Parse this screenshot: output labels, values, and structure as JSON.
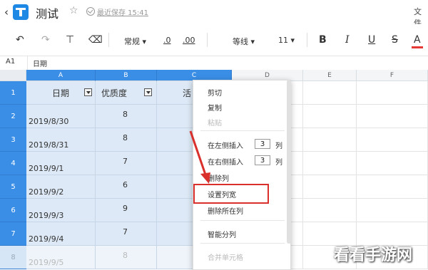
{
  "title_bar": {
    "back_glyph": "‹",
    "doc_title": "测试",
    "save_status": "最近保存 15:41",
    "file_menu": "文件"
  },
  "toolbar": {
    "font_format": "常规",
    "dec_decrease": ".0",
    "dec_increase": ".00",
    "font_name": "等线",
    "font_size": "11",
    "bold": "B",
    "italic": "I",
    "underline": "U",
    "strike": "S",
    "font_color": "A"
  },
  "formula_bar": {
    "cell_ref": "A1",
    "value": "日期"
  },
  "columns": [
    "A",
    "B",
    "C",
    "D",
    "E",
    "F"
  ],
  "header_row": {
    "row_no": "1",
    "date_header": "日期",
    "quality_header": "优质度",
    "c_header": "活"
  },
  "rows": [
    {
      "row_no": "2",
      "date": "2019/8/30",
      "value": "8"
    },
    {
      "row_no": "3",
      "date": "2019/8/31",
      "value": "8"
    },
    {
      "row_no": "4",
      "date": "2019/9/1",
      "value": "7"
    },
    {
      "row_no": "5",
      "date": "2019/9/2",
      "value": "6"
    },
    {
      "row_no": "6",
      "date": "2019/9/3",
      "value": "9"
    },
    {
      "row_no": "7",
      "date": "2019/9/4",
      "value": "7"
    },
    {
      "row_no": "8",
      "date": "2019/9/5",
      "value": "8"
    }
  ],
  "context_menu": {
    "cut": "剪切",
    "copy": "复制",
    "paste": "粘贴",
    "insert_left": "在左侧插入",
    "insert_left_count": "3",
    "insert_left_unit": "列",
    "insert_right": "在右侧插入",
    "insert_right_count": "3",
    "insert_right_unit": "列",
    "delete_col": "删除列",
    "set_width": "设置列宽",
    "delete_all": "删除所在列",
    "smart_split": "智能分列",
    "merge_cells": "合并单元格"
  },
  "colors": {
    "accent": "#3a8ee6",
    "highlight_box": "#d9302c",
    "arrow": "#d9302c"
  },
  "watermark": "看看手游网"
}
